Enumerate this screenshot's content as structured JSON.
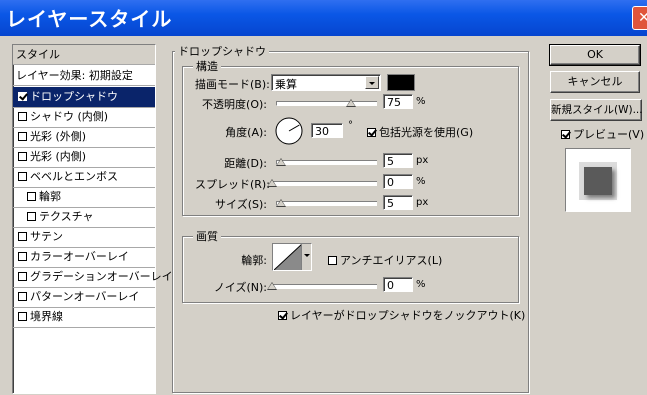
{
  "window": {
    "title": "レイヤースタイル"
  },
  "styles": {
    "header": "スタイル",
    "blend_options": "レイヤー効果: 初期設定",
    "items": [
      {
        "label": "ドロップシャドウ",
        "checked": true,
        "selected": true,
        "indent": false
      },
      {
        "label": "シャドウ (内側)",
        "checked": false,
        "selected": false,
        "indent": false
      },
      {
        "label": "光彩 (外側)",
        "checked": false,
        "selected": false,
        "indent": false
      },
      {
        "label": "光彩 (内側)",
        "checked": false,
        "selected": false,
        "indent": false
      },
      {
        "label": "ベベルとエンボス",
        "checked": false,
        "selected": false,
        "indent": false
      },
      {
        "label": "輪郭",
        "checked": false,
        "selected": false,
        "indent": true
      },
      {
        "label": "テクスチャ",
        "checked": false,
        "selected": false,
        "indent": true
      },
      {
        "label": "サテン",
        "checked": false,
        "selected": false,
        "indent": false
      },
      {
        "label": "カラーオーバーレイ",
        "checked": false,
        "selected": false,
        "indent": false
      },
      {
        "label": "グラデーションオーバーレイ",
        "checked": false,
        "selected": false,
        "indent": false
      },
      {
        "label": "パターンオーバーレイ",
        "checked": false,
        "selected": false,
        "indent": false
      },
      {
        "label": "境界線",
        "checked": false,
        "selected": false,
        "indent": false
      }
    ]
  },
  "drop_shadow": {
    "title": "ドロップシャドウ",
    "structure": {
      "title": "構造",
      "blend_mode_label": "描画モード(B):",
      "blend_mode_value": "乗算",
      "shadow_color": "#000000",
      "opacity_label": "不透明度(O):",
      "opacity_value": "75",
      "opacity_unit": "%",
      "opacity_level": 75,
      "angle_label": "角度(A):",
      "angle_value": "30",
      "angle_unit": "°",
      "global_light_label": "包括光源を使用(G)",
      "global_light_checked": true,
      "distance_label": "距離(D):",
      "distance_value": "5",
      "distance_unit": "px",
      "spread_label": "スプレッド(R):",
      "spread_value": "0",
      "spread_unit": "%",
      "size_label": "サイズ(S):",
      "size_value": "5",
      "size_unit": "px"
    },
    "quality": {
      "title": "画質",
      "contour_label": "輪郭:",
      "antialias_label": "アンチエイリアス(L)",
      "antialias_checked": false,
      "noise_label": "ノイズ(N):",
      "noise_value": "0",
      "noise_unit": "%"
    },
    "knockout_label": "レイヤーがドロップシャドウをノックアウト(K)",
    "knockout_checked": true
  },
  "buttons": {
    "ok": "OK",
    "cancel": "キャンセル",
    "new_style": "新規スタイル(W)...",
    "preview_label": "プレビュー(V)",
    "preview_checked": true
  }
}
